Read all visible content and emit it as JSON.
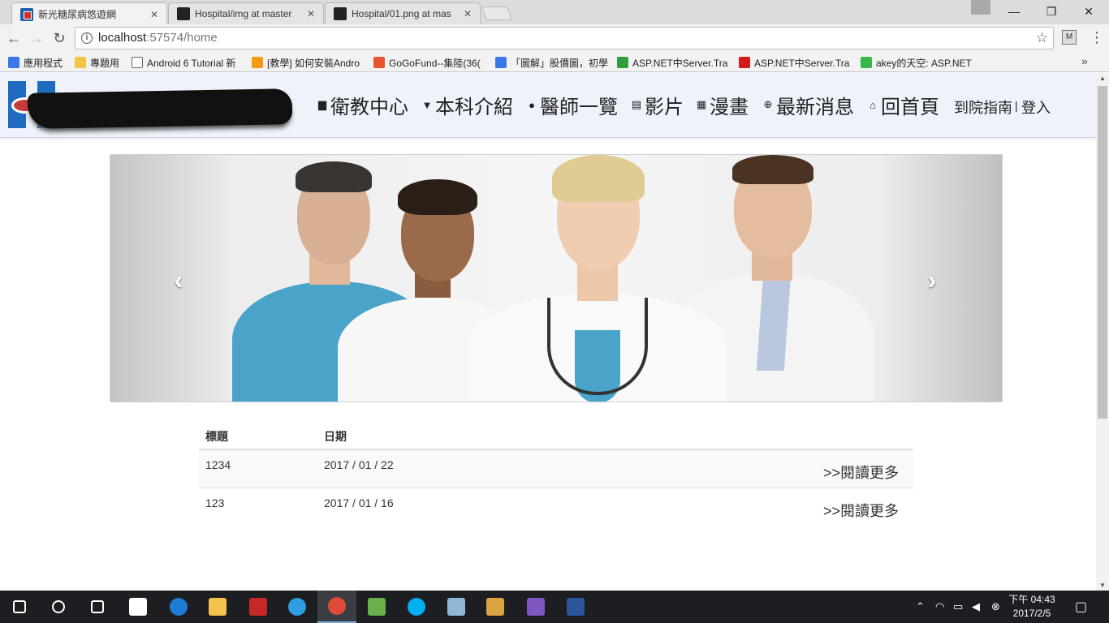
{
  "browser": {
    "tabs": [
      {
        "title": "新光糖尿病悠遊網",
        "favicon": "hospital-favicon",
        "active": true
      },
      {
        "title": "Hospital/img at master",
        "favicon": "github-icon",
        "active": false
      },
      {
        "title": "Hospital/01.png at mas",
        "favicon": "github-icon",
        "active": false
      }
    ],
    "close_glyph": "✕",
    "window": {
      "minimize": "—",
      "maximize": "❐",
      "close": "✕"
    },
    "address": {
      "host": "localhost",
      "path": ":57574/home"
    },
    "bookmarks": [
      {
        "label": "應用程式",
        "icon": "apps-grid-icon",
        "color": "#3b78e7"
      },
      {
        "label": "專題用",
        "icon": "folder-icon",
        "color": "#f4c542"
      },
      {
        "label": "Android 6 Tutorial 新",
        "icon": "page-icon",
        "color": "#ffffff"
      },
      {
        "label": "[教學] 如何安裝Andro",
        "icon": "orange-circle-icon",
        "color": "#f39c12"
      },
      {
        "label": "GoGoFund--集陸(36(",
        "icon": "g-icon",
        "color": "#e8542f"
      },
      {
        "label": "「圖解」股價圖，初學",
        "icon": "edit-icon",
        "color": "#3b78e7"
      },
      {
        "label": "ASP.NET中Server.Tra",
        "icon": "s-icon",
        "color": "#2e9e3e"
      },
      {
        "label": "ASP.NET中Server.Tra",
        "icon": "c-icon",
        "color": "#d61a1a"
      },
      {
        "label": "akey的天空: ASP.NET",
        "icon": "chat-icon",
        "color": "#39b54a"
      }
    ],
    "bookmarks_more": "»"
  },
  "site": {
    "nav": [
      {
        "icon": "book-icon",
        "glyph": "▆",
        "label": "衛教中心"
      },
      {
        "icon": "bookmark-icon",
        "glyph": "▼",
        "label": "本科介紹"
      },
      {
        "icon": "user-icon",
        "glyph": "●",
        "label": "醫師一覽"
      },
      {
        "icon": "film-icon",
        "glyph": "▤",
        "label": "影片"
      },
      {
        "icon": "grid-icon",
        "glyph": "▦",
        "label": "漫畫"
      },
      {
        "icon": "search-icon",
        "glyph": "⊕",
        "label": "最新消息"
      },
      {
        "icon": "home-icon",
        "glyph": "⌂",
        "label": "回首頁"
      }
    ],
    "guide_link": "到院指南",
    "separator": "|",
    "login_link": "登入",
    "carousel": {
      "prev": "‹",
      "next": "›"
    },
    "news": {
      "headers": {
        "title": "標題",
        "date": "日期"
      },
      "rows": [
        {
          "title": "1234",
          "date": "2017 / 01 / 22",
          "more": ">>閱讀更多"
        },
        {
          "title": "123",
          "date": "2017 / 01 / 16",
          "more": ">>閱讀更多"
        }
      ]
    }
  },
  "taskbar": {
    "time": "下午 04:43",
    "date": "2017/2/5",
    "apps": [
      {
        "name": "windows-start-icon",
        "color": "#ffffff"
      },
      {
        "name": "search-icon",
        "color": "#ffffff"
      },
      {
        "name": "task-view-icon",
        "color": "#ffffff"
      },
      {
        "name": "store-icon",
        "color": "#ffffff"
      },
      {
        "name": "edge-icon",
        "color": "#1e7bd6"
      },
      {
        "name": "file-explorer-icon",
        "color": "#f2c14e"
      },
      {
        "name": "app-red-icon",
        "color": "#c62828"
      },
      {
        "name": "internet-explorer-icon",
        "color": "#2d9ee0"
      },
      {
        "name": "chrome-icon",
        "color": "#dd4b39"
      },
      {
        "name": "notepad-icon",
        "color": "#6ab04c"
      },
      {
        "name": "skype-icon",
        "color": "#00aff0"
      },
      {
        "name": "tablet-icon",
        "color": "#8fb8d8"
      },
      {
        "name": "paint-icon",
        "color": "#d9a441"
      },
      {
        "name": "visual-studio-icon",
        "color": "#7e57c2"
      },
      {
        "name": "word-icon",
        "color": "#2b579a"
      }
    ]
  }
}
